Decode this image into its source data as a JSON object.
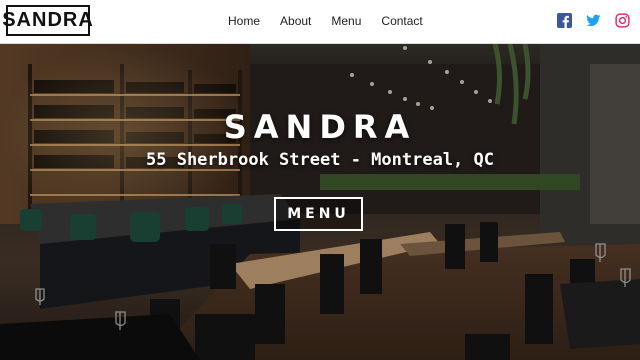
{
  "brand": {
    "logo_text": "SANDRA"
  },
  "nav": {
    "items": [
      {
        "label": "Home"
      },
      {
        "label": "About"
      },
      {
        "label": "Menu"
      },
      {
        "label": "Contact"
      }
    ]
  },
  "social": {
    "icons": [
      {
        "name": "facebook-icon",
        "color": "#3b5998"
      },
      {
        "name": "twitter-icon",
        "color": "#1da1f2"
      },
      {
        "name": "instagram-icon",
        "color": "#e1306c"
      }
    ]
  },
  "hero": {
    "title": "SANDRA",
    "address": "55 Sherbrook Street - Montreal, QC",
    "menu_button": "MENU"
  }
}
